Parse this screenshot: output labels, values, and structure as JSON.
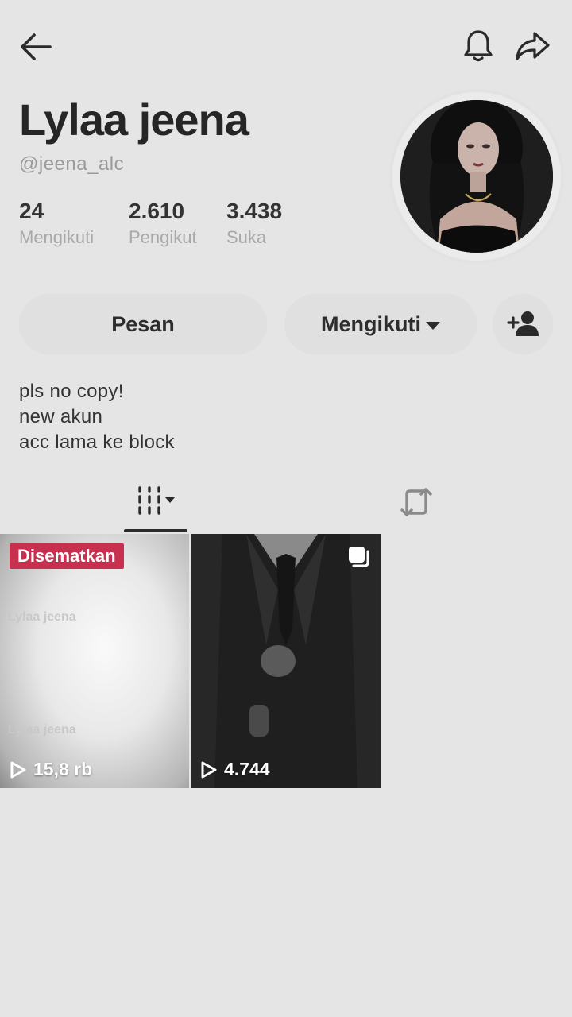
{
  "profile": {
    "display_name": "Lylaa jeena",
    "username": "@jeena_alc",
    "stats": {
      "following": {
        "value": "24",
        "label": "Mengikuti"
      },
      "followers": {
        "value": "2.610",
        "label": "Pengikut"
      },
      "likes": {
        "value": "3.438",
        "label": "Suka"
      }
    }
  },
  "actions": {
    "message_label": "Pesan",
    "following_label": "Mengikuti"
  },
  "bio": [
    "pls no copy!",
    "new akun",
    "acc lama ke block"
  ],
  "tabs": {
    "videos_icon": "grid-lines-icon",
    "reposts_icon": "repost-icon"
  },
  "videos": [
    {
      "pinned_label": "Disematkan",
      "views": "15,8 rb",
      "ghost_text": "Lylaa jeena"
    },
    {
      "views": "4.744",
      "multi_icon": "multi-photo-icon"
    }
  ],
  "colors": {
    "background": "#e5e5e5",
    "pinned_badge": "#c8304f",
    "text": "#2a2a2a"
  }
}
